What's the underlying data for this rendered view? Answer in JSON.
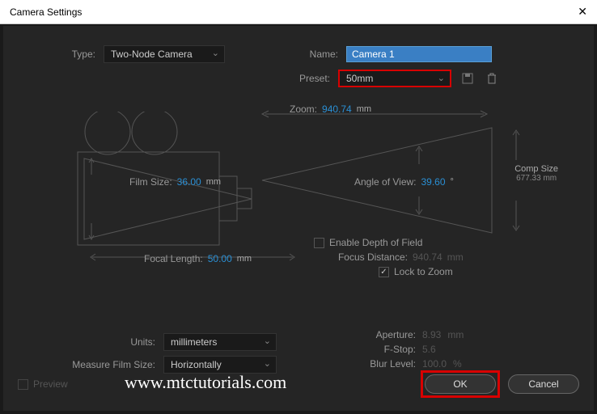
{
  "window": {
    "title": "Camera Settings"
  },
  "type": {
    "label": "Type:",
    "value": "Two-Node Camera"
  },
  "name": {
    "label": "Name:",
    "value": "Camera 1"
  },
  "preset": {
    "label": "Preset:",
    "value": "50mm"
  },
  "zoom": {
    "label": "Zoom:",
    "value": "940.74",
    "unit": "mm"
  },
  "film_size": {
    "label": "Film Size:",
    "value": "36.00",
    "unit": "mm"
  },
  "angle_of_view": {
    "label": "Angle of View:",
    "value": "39.60",
    "unit": "°"
  },
  "comp_size": {
    "label": "Comp Size",
    "value": "677.33 mm"
  },
  "focal_length": {
    "label": "Focal Length:",
    "value": "50.00",
    "unit": "mm"
  },
  "dof": {
    "enable_label": "Enable Depth of Field",
    "enable_checked": false,
    "focus_distance": {
      "label": "Focus Distance:",
      "value": "940.74",
      "unit": "mm"
    },
    "lock_to_zoom": {
      "label": "Lock to Zoom",
      "checked": true
    },
    "aperture": {
      "label": "Aperture:",
      "value": "8.93",
      "unit": "mm"
    },
    "fstop": {
      "label": "F-Stop:",
      "value": "5.6"
    },
    "blur_level": {
      "label": "Blur Level:",
      "value": "100.0",
      "unit": "%"
    }
  },
  "units": {
    "label": "Units:",
    "value": "millimeters"
  },
  "measure_film": {
    "label": "Measure Film Size:",
    "value": "Horizontally"
  },
  "watermark": "www.mtctutorials.com",
  "buttons": {
    "ok": "OK",
    "cancel": "Cancel",
    "preview": "Preview"
  }
}
